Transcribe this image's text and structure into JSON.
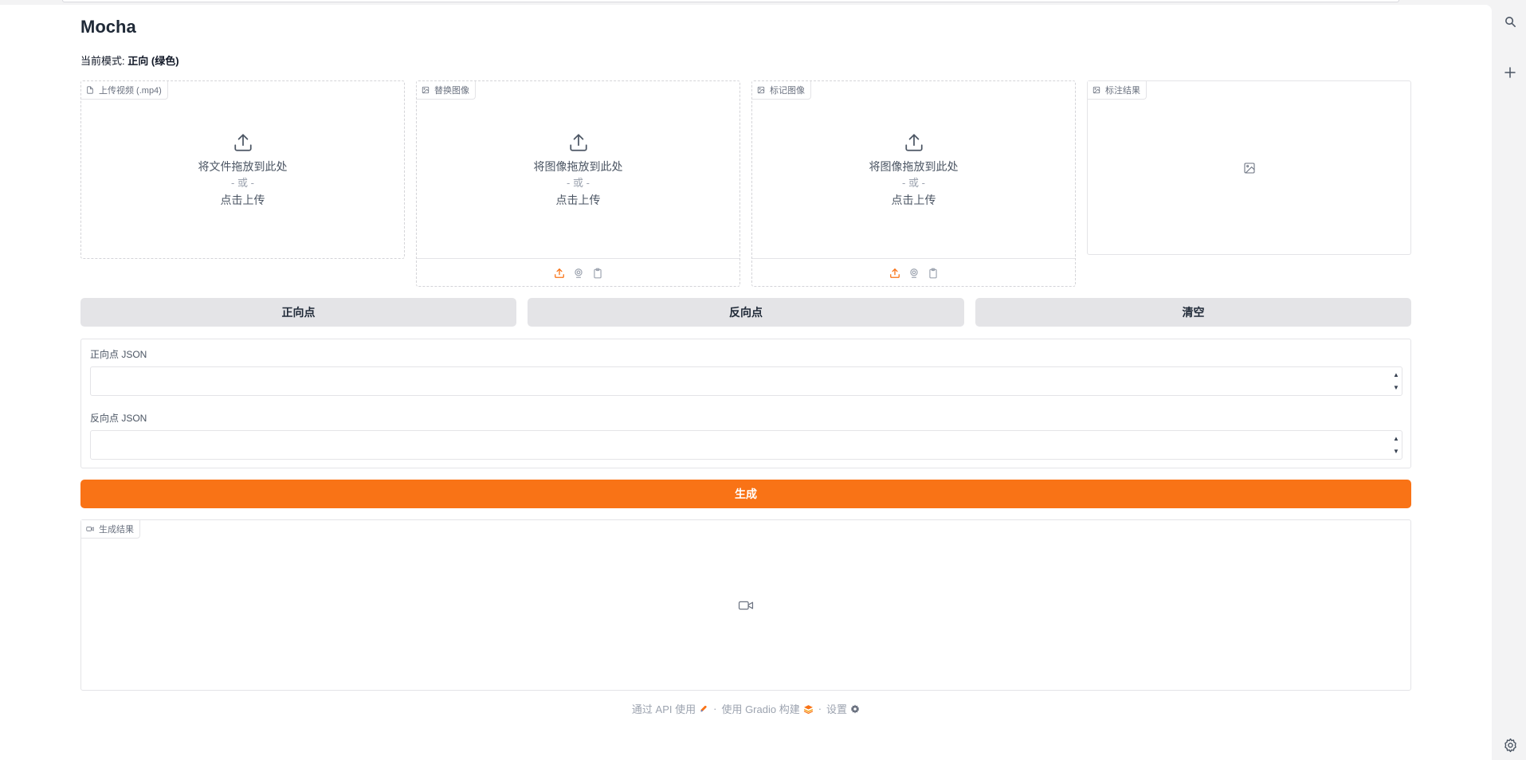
{
  "app": {
    "title": "Mocha",
    "mode_prefix": "当前模式:",
    "mode_value": "正向 (绿色)"
  },
  "uploads": [
    {
      "label": "上传视频 (.mp4)",
      "drop_text": "将文件拖放到此处",
      "or_text": "- 或 -",
      "click_text": "点击上传"
    },
    {
      "label": "替换图像",
      "drop_text": "将图像拖放到此处",
      "or_text": "- 或 -",
      "click_text": "点击上传"
    },
    {
      "label": "标记图像",
      "drop_text": "将图像拖放到此处",
      "or_text": "- 或 -",
      "click_text": "点击上传"
    },
    {
      "label": "标注结果"
    }
  ],
  "buttons": {
    "positive": "正向点",
    "negative": "反向点",
    "clear": "清空",
    "generate": "生成"
  },
  "json_fields": {
    "positive_label": "正向点 JSON",
    "positive_value": "",
    "negative_label": "反向点 JSON",
    "negative_value": ""
  },
  "output": {
    "label": "生成结果"
  },
  "footer": {
    "api": "通过 API 使用",
    "gradio": "使用 Gradio 构建",
    "settings": "设置",
    "separator": "·"
  },
  "colors": {
    "accent": "#f97316",
    "button_gray": "#e4e4e7",
    "border": "#e4e4e7"
  },
  "icons": {
    "rail": [
      "search-icon",
      "plus-icon",
      "settings-icon"
    ],
    "toolbar": [
      "upload-icon",
      "webcam-icon",
      "clipboard-icon"
    ]
  }
}
